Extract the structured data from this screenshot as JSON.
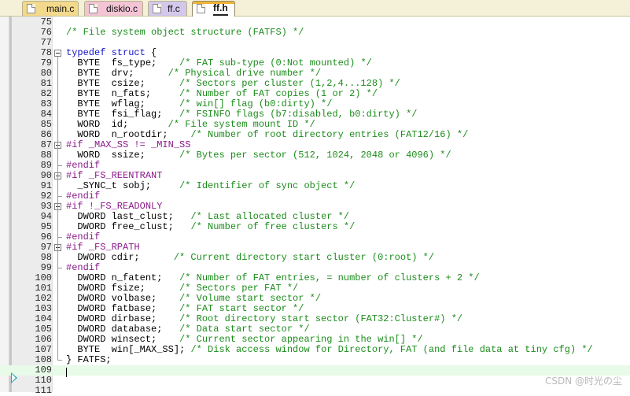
{
  "tabs": [
    {
      "label": "main.c",
      "active": false,
      "color": "#f3d98b"
    },
    {
      "label": "diskio.c",
      "active": false,
      "color": "#f2c4d4"
    },
    {
      "label": "ff.c",
      "active": false,
      "color": "#d3c8ec"
    },
    {
      "label": "ff.h",
      "active": true,
      "color": "#ffffff"
    }
  ],
  "editor": {
    "current_line": 109,
    "execution_arrow_line": 108,
    "lines": [
      {
        "n": "75",
        "segs": []
      },
      {
        "n": "76",
        "segs": [
          {
            "c": "/* File system object structure (FATFS) */",
            "t": "cm"
          }
        ]
      },
      {
        "n": "77",
        "segs": []
      },
      {
        "n": "78",
        "fold": true,
        "segs": [
          {
            "c": "typedef struct",
            "t": "kw"
          },
          {
            "c": " {",
            "t": "tx"
          }
        ]
      },
      {
        "n": "79",
        "segs": [
          {
            "c": "  BYTE  fs_type;    ",
            "t": "tx"
          },
          {
            "c": "/* FAT sub-type (0:Not mounted) */",
            "t": "cm"
          }
        ]
      },
      {
        "n": "80",
        "segs": [
          {
            "c": "  BYTE  drv;      ",
            "t": "tx"
          },
          {
            "c": "/* Physical drive number */",
            "t": "cm"
          }
        ]
      },
      {
        "n": "81",
        "segs": [
          {
            "c": "  BYTE  csize;      ",
            "t": "tx"
          },
          {
            "c": "/* Sectors per cluster (1,2,4...128) */",
            "t": "cm"
          }
        ]
      },
      {
        "n": "82",
        "segs": [
          {
            "c": "  BYTE  n_fats;     ",
            "t": "tx"
          },
          {
            "c": "/* Number of FAT copies (1 or 2) */",
            "t": "cm"
          }
        ]
      },
      {
        "n": "83",
        "segs": [
          {
            "c": "  BYTE  wflag;      ",
            "t": "tx"
          },
          {
            "c": "/* win[] flag (b0:dirty) */",
            "t": "cm"
          }
        ]
      },
      {
        "n": "84",
        "segs": [
          {
            "c": "  BYTE  fsi_flag;   ",
            "t": "tx"
          },
          {
            "c": "/* FSINFO flags (b7:disabled, b0:dirty) */",
            "t": "cm"
          }
        ]
      },
      {
        "n": "85",
        "segs": [
          {
            "c": "  WORD  id;       ",
            "t": "tx"
          },
          {
            "c": "/* File system mount ID */",
            "t": "cm"
          }
        ]
      },
      {
        "n": "86",
        "segs": [
          {
            "c": "  WORD  n_rootdir;    ",
            "t": "tx"
          },
          {
            "c": "/* Number of root directory entries (FAT12/16) */",
            "t": "cm"
          }
        ]
      },
      {
        "n": "87",
        "fold": true,
        "segs": [
          {
            "c": "#if _MAX_SS != _MIN_SS",
            "t": "pp"
          }
        ]
      },
      {
        "n": "88",
        "segs": [
          {
            "c": "  WORD  ssize;      ",
            "t": "tx"
          },
          {
            "c": "/* Bytes per sector (512, 1024, 2048 or 4096) */",
            "t": "cm"
          }
        ]
      },
      {
        "n": "89",
        "foldend": true,
        "segs": [
          {
            "c": "#endif",
            "t": "pp"
          }
        ]
      },
      {
        "n": "90",
        "fold": true,
        "segs": [
          {
            "c": "#if _FS_REENTRANT",
            "t": "pp"
          }
        ]
      },
      {
        "n": "91",
        "segs": [
          {
            "c": "  _SYNC_t sobj;     ",
            "t": "tx"
          },
          {
            "c": "/* Identifier of sync object */",
            "t": "cm"
          }
        ]
      },
      {
        "n": "92",
        "foldend": true,
        "segs": [
          {
            "c": "#endif",
            "t": "pp"
          }
        ]
      },
      {
        "n": "93",
        "fold": true,
        "segs": [
          {
            "c": "#if !_FS_READONLY",
            "t": "pp"
          }
        ]
      },
      {
        "n": "94",
        "segs": [
          {
            "c": "  DWORD last_clust;   ",
            "t": "tx"
          },
          {
            "c": "/* Last allocated cluster */",
            "t": "cm"
          }
        ]
      },
      {
        "n": "95",
        "segs": [
          {
            "c": "  DWORD free_clust;   ",
            "t": "tx"
          },
          {
            "c": "/* Number of free clusters */",
            "t": "cm"
          }
        ]
      },
      {
        "n": "96",
        "foldend": true,
        "segs": [
          {
            "c": "#endif",
            "t": "pp"
          }
        ]
      },
      {
        "n": "97",
        "fold": true,
        "segs": [
          {
            "c": "#if _FS_RPATH",
            "t": "pp"
          }
        ]
      },
      {
        "n": "98",
        "segs": [
          {
            "c": "  DWORD cdir;      ",
            "t": "tx"
          },
          {
            "c": "/* Current directory start cluster (0:root) */",
            "t": "cm"
          }
        ]
      },
      {
        "n": "99",
        "foldend": true,
        "segs": [
          {
            "c": "#endif",
            "t": "pp"
          }
        ]
      },
      {
        "n": "100",
        "segs": [
          {
            "c": "  DWORD n_fatent;   ",
            "t": "tx"
          },
          {
            "c": "/* Number of FAT entries, = number of clusters + 2 */",
            "t": "cm"
          }
        ]
      },
      {
        "n": "101",
        "segs": [
          {
            "c": "  DWORD fsize;      ",
            "t": "tx"
          },
          {
            "c": "/* Sectors per FAT */",
            "t": "cm"
          }
        ]
      },
      {
        "n": "102",
        "segs": [
          {
            "c": "  DWORD volbase;    ",
            "t": "tx"
          },
          {
            "c": "/* Volume start sector */",
            "t": "cm"
          }
        ]
      },
      {
        "n": "103",
        "segs": [
          {
            "c": "  DWORD fatbase;    ",
            "t": "tx"
          },
          {
            "c": "/* FAT start sector */",
            "t": "cm"
          }
        ]
      },
      {
        "n": "104",
        "segs": [
          {
            "c": "  DWORD dirbase;    ",
            "t": "tx"
          },
          {
            "c": "/* Root directory start sector (FAT32:Cluster#) */",
            "t": "cm"
          }
        ]
      },
      {
        "n": "105",
        "segs": [
          {
            "c": "  DWORD database;   ",
            "t": "tx"
          },
          {
            "c": "/* Data start sector */",
            "t": "cm"
          }
        ]
      },
      {
        "n": "106",
        "segs": [
          {
            "c": "  DWORD winsect;    ",
            "t": "tx"
          },
          {
            "c": "/* Current sector appearing in the win[] */",
            "t": "cm"
          }
        ]
      },
      {
        "n": "107",
        "segs": [
          {
            "c": "  BYTE  win[_MAX_SS]; ",
            "t": "tx"
          },
          {
            "c": "/* Disk access window for Directory, FAT (and file data at tiny cfg) */",
            "t": "cm"
          }
        ]
      },
      {
        "n": "108",
        "foldend": true,
        "segs": [
          {
            "c": "} FATFS;",
            "t": "tx"
          }
        ]
      },
      {
        "n": "109",
        "segs": []
      },
      {
        "n": "110",
        "segs": []
      },
      {
        "n": "111",
        "segs": []
      }
    ]
  },
  "watermark": "CSDN @时光の尘",
  "colors": {
    "keyword": "#1515c8",
    "preprocessor": "#8b1a8b",
    "comment": "#1c8c1c",
    "text": "#000000",
    "current_line_bg": "#e8fbe8",
    "exec_arrow": "#18a7b5"
  }
}
